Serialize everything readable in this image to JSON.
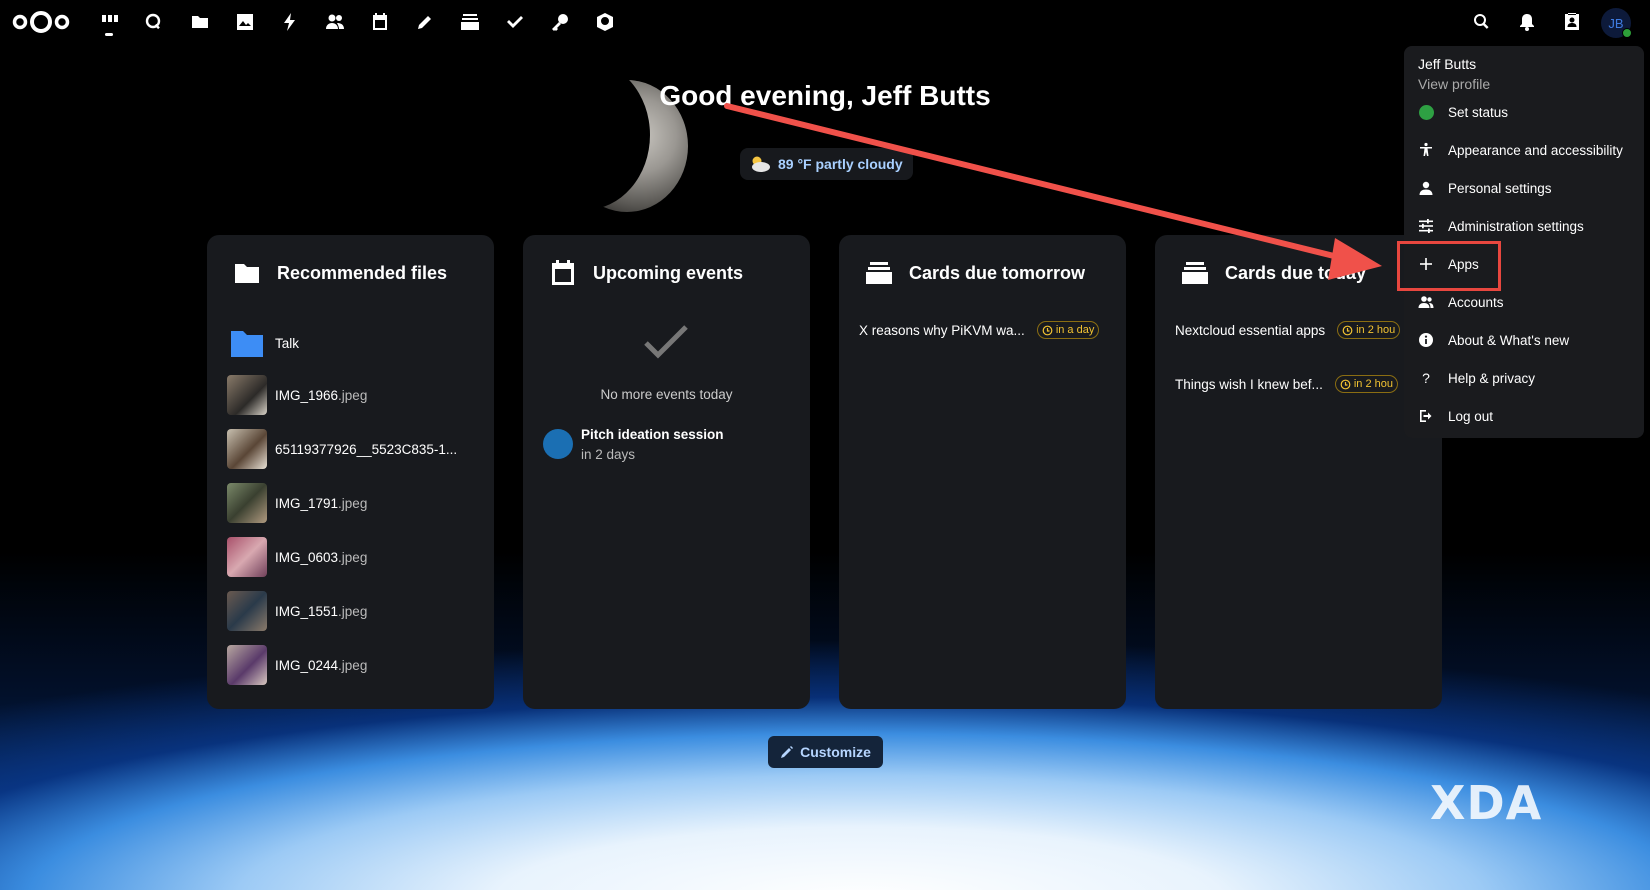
{
  "topbar": {
    "apps": [
      {
        "name": "dashboard",
        "icon": "dashboard-icon"
      },
      {
        "name": "search",
        "icon": "unified-search-icon"
      },
      {
        "name": "files",
        "icon": "folder-icon"
      },
      {
        "name": "photos",
        "icon": "image-icon"
      },
      {
        "name": "activity",
        "icon": "lightning-icon"
      },
      {
        "name": "contacts",
        "icon": "contacts-icon"
      },
      {
        "name": "calendar",
        "icon": "calendar-icon"
      },
      {
        "name": "notes",
        "icon": "pencil-icon"
      },
      {
        "name": "deck",
        "icon": "deck-icon"
      },
      {
        "name": "tasks",
        "icon": "checkmark-icon"
      },
      {
        "name": "passwords",
        "icon": "key-icon"
      },
      {
        "name": "app",
        "icon": "hexagon-icon"
      }
    ],
    "avatar_initials": "JB"
  },
  "greeting": "Good evening, Jeff Butts",
  "weather": "89 °F partly cloudy",
  "panels": {
    "recommended": {
      "title": "Recommended files",
      "files": [
        {
          "name": "Talk",
          "ext": "",
          "type": "folder"
        },
        {
          "name": "IMG_1966",
          "ext": ".jpeg",
          "type": "image"
        },
        {
          "name": "65119377926__5523C835-1...",
          "ext": "",
          "type": "image"
        },
        {
          "name": "IMG_1791",
          "ext": ".jpeg",
          "type": "image"
        },
        {
          "name": "IMG_0603",
          "ext": ".jpeg",
          "type": "image"
        },
        {
          "name": "IMG_1551",
          "ext": ".jpeg",
          "type": "image"
        },
        {
          "name": "IMG_0244",
          "ext": ".jpeg",
          "type": "image"
        }
      ]
    },
    "events": {
      "title": "Upcoming events",
      "empty_text": "No more events today",
      "event_title": "Pitch ideation session",
      "event_time": "in 2 days"
    },
    "tomorrow": {
      "title": "Cards due tomorrow",
      "cards": [
        {
          "title": "X reasons why PiKVM wa...",
          "due": "in a day"
        }
      ]
    },
    "today": {
      "title": "Cards due today",
      "cards": [
        {
          "title": "Nextcloud essential apps",
          "due": "in 2 hou"
        },
        {
          "title": "Things wish I knew bef...",
          "due": "in 2 hou"
        }
      ]
    }
  },
  "customize_label": "Customize",
  "menu": {
    "name": "Jeff Butts",
    "view_profile": "View profile",
    "items": [
      {
        "label": "Set status",
        "icon": "status-dot-icon"
      },
      {
        "label": "Appearance and accessibility",
        "icon": "accessibility-icon"
      },
      {
        "label": "Personal settings",
        "icon": "person-icon"
      },
      {
        "label": "Administration settings",
        "icon": "sliders-icon"
      },
      {
        "label": "Apps",
        "icon": "plus-icon"
      },
      {
        "label": "Accounts",
        "icon": "accounts-icon"
      },
      {
        "label": "About & What's new",
        "icon": "info-icon"
      },
      {
        "label": "Help & privacy",
        "icon": "question-icon"
      },
      {
        "label": "Log out",
        "icon": "logout-icon"
      }
    ]
  },
  "watermark": "XDA",
  "colors": {
    "accent": "#e8473f",
    "status": "#2ea043",
    "due": "#f1c232"
  }
}
